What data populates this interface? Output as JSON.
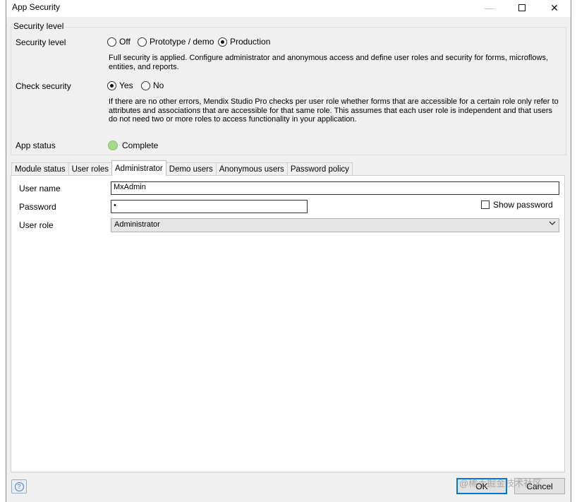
{
  "window": {
    "title": "App Security",
    "minimize_glyph": "—",
    "close_glyph": "✕"
  },
  "security": {
    "group_legend": "Security level",
    "level_label": "Security level",
    "level_options": [
      {
        "label": "Off",
        "checked": false
      },
      {
        "label": "Prototype / demo",
        "checked": false
      },
      {
        "label": "Production",
        "checked": true
      }
    ],
    "level_description": "Full security is applied. Configure administrator and anonymous access and define user roles and security for forms, microflows, entities, and reports.",
    "check_label": "Check security",
    "check_options": [
      {
        "label": "Yes",
        "checked": true
      },
      {
        "label": "No",
        "checked": false
      }
    ],
    "check_description": "If there are no other errors, Mendix Studio Pro checks per user role whether forms that are accessible for a certain role only refer to attributes and associations that are accessible for that same role. This assumes that each user role is independent and that users do not need two or more roles to access functionality in your application.",
    "status_label": "App status",
    "status_value": "Complete",
    "status_color": "#a6d98a"
  },
  "tabs": [
    {
      "label": "Module status",
      "active": false
    },
    {
      "label": "User roles",
      "active": false
    },
    {
      "label": "Administrator",
      "active": true
    },
    {
      "label": "Demo users",
      "active": false
    },
    {
      "label": "Anonymous users",
      "active": false
    },
    {
      "label": "Password policy",
      "active": false
    }
  ],
  "admin": {
    "username_label": "User name",
    "username_value": "MxAdmin",
    "password_label": "Password",
    "password_value": "•",
    "show_password_label": "Show password",
    "show_password_checked": false,
    "userrole_label": "User role",
    "userrole_value": "Administrator"
  },
  "footer": {
    "help_icon": "help-icon",
    "ok_label": "OK",
    "cancel_label": "Cancel",
    "watermark": "@稀土掘金技术社区"
  }
}
